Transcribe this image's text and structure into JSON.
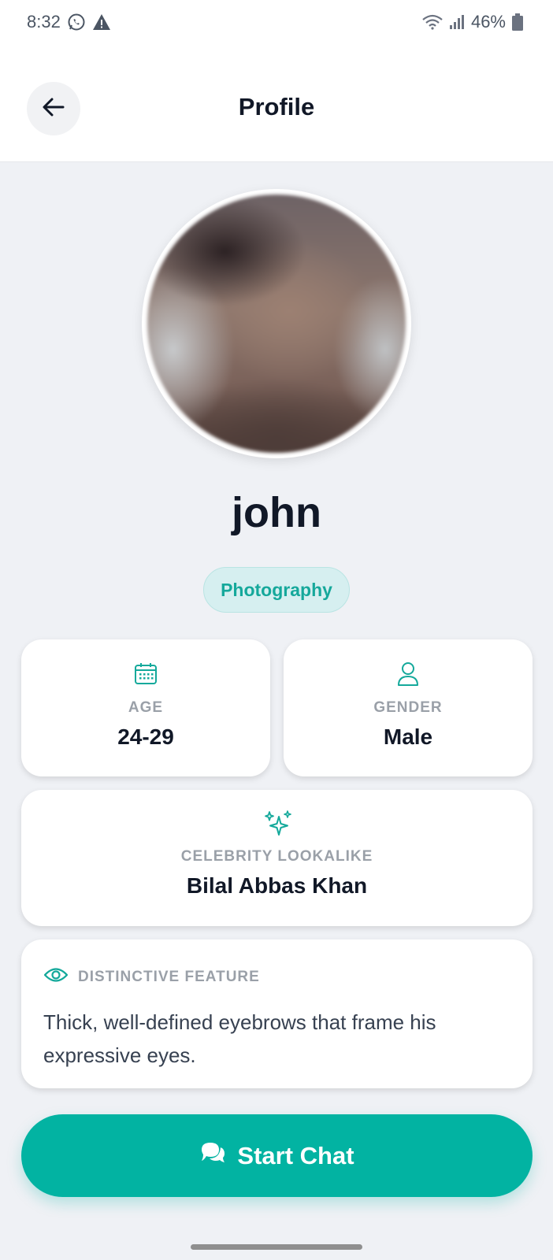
{
  "status_bar": {
    "time": "8:32",
    "battery": "46%",
    "icons": [
      "whatsapp-icon",
      "warning-icon",
      "wifi-icon",
      "signal-icon",
      "battery-icon"
    ]
  },
  "header": {
    "title": "Profile",
    "back_icon": "arrow-left-icon"
  },
  "profile": {
    "name": "john",
    "interest_tag": "Photography",
    "age": {
      "label": "AGE",
      "value": "24-29",
      "icon": "calendar-icon"
    },
    "gender": {
      "label": "GENDER",
      "value": "Male",
      "icon": "user-icon"
    },
    "celebrity": {
      "label": "CELEBRITY LOOKALIKE",
      "value": "Bilal Abbas Khan",
      "icon": "sparkles-icon"
    },
    "feature": {
      "label": "DISTINCTIVE FEATURE",
      "text": "Thick, well-defined eyebrows that frame his expressive eyes.",
      "icon": "eye-icon"
    }
  },
  "actions": {
    "start_chat_label": "Start Chat",
    "start_chat_icon": "chat-bubbles-icon"
  },
  "colors": {
    "accent": "#02b3a2",
    "tag_bg": "#d6eff0",
    "page_bg": "#eff1f5"
  }
}
